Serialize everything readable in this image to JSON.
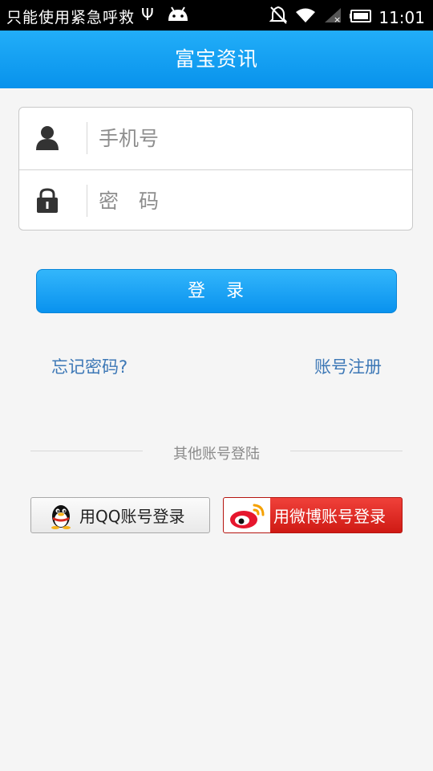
{
  "status_bar": {
    "emergency_text": "只能使用紧急呼救",
    "usb_icon": "usb-icon",
    "android_icon": "android-icon",
    "notification_muted_icon": "notification-off-icon",
    "wifi_icon": "wifi-icon",
    "signal_icon": "signal-no-service-icon",
    "battery_icon": "battery-icon",
    "time": "11:01"
  },
  "header": {
    "title": "富宝资讯"
  },
  "login_form": {
    "phone_placeholder": "手机号",
    "phone_value": "",
    "phone_icon": "user-icon",
    "password_placeholder": "密　码",
    "password_value": "",
    "password_icon": "lock-icon"
  },
  "actions": {
    "login_label": "登　录",
    "forgot_password": "忘记密码?",
    "register": "账号注册"
  },
  "other_login": {
    "label": "其他账号登陆",
    "qq_label": "用QQ账号登录",
    "qq_icon": "qq-penguin-icon",
    "weibo_label": "用微博账号登录",
    "weibo_icon": "weibo-icon"
  },
  "colors": {
    "title_bar": "#0f9bf0",
    "login_button": "#1aa3f4",
    "link": "#3d78b6",
    "weibo_red": "#e0271f",
    "background": "#f5f5f5"
  }
}
